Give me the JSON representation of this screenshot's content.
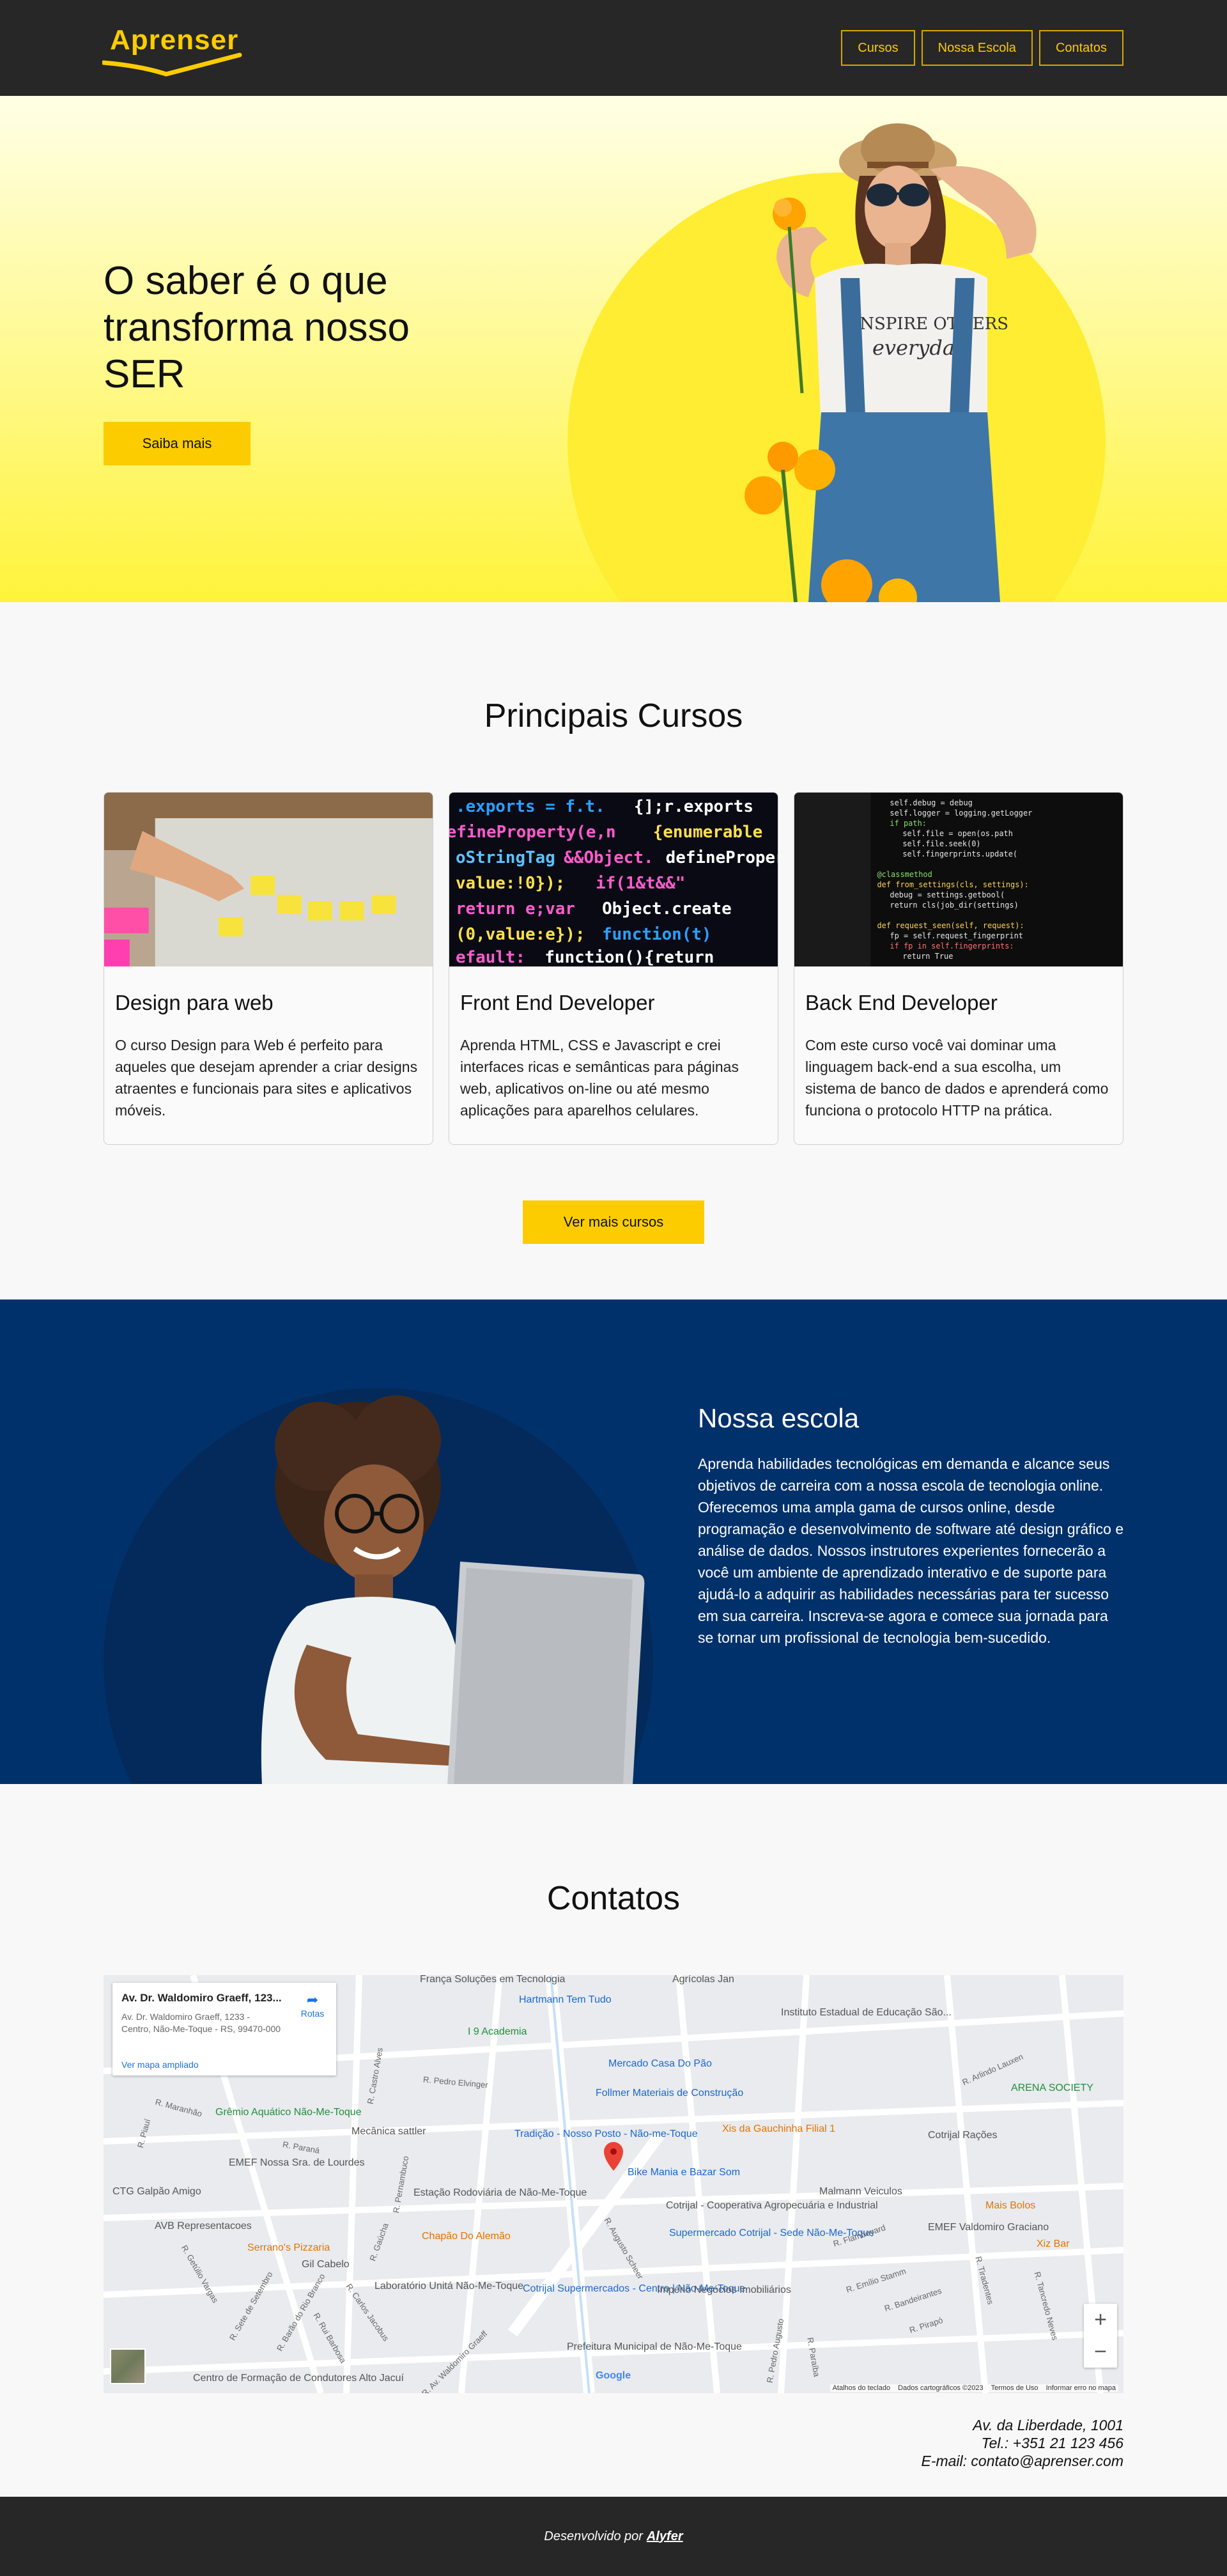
{
  "header": {
    "logo_text": "Aprenser",
    "nav": [
      "Cursos",
      "Nossa Escola",
      "Contatos"
    ]
  },
  "hero": {
    "title": "O saber é o que transforma nosso SER",
    "button": "Saiba mais",
    "shirt_text_1": "INSPIRE OTHERS",
    "shirt_text_2": "everyday"
  },
  "courses": {
    "title": "Principais Cursos",
    "items": [
      {
        "title": "Design para web",
        "description": "O curso Design para Web é perfeito para aqueles que desejam aprender a criar designs atraentes e funcionais para sites e aplicativos móveis."
      },
      {
        "title": "Front End Developer",
        "description": "Aprenda HTML, CSS e Javascript e crei interfaces ricas e semânticas para páginas web, aplicativos on-line ou até mesmo aplicações para aparelhos celulares."
      },
      {
        "title": "Back End Developer",
        "description": "Com este curso você vai dominar uma linguagem back-end a sua escolha, um sistema de banco de dados e aprenderá como funciona o protocolo HTTP na prática."
      }
    ],
    "more_button": "Ver mais cursos"
  },
  "school": {
    "title": "Nossa escola",
    "text": "Aprenda habilidades tecnológicas em demanda e alcance seus objetivos de carreira com a nossa escola de tecnologia online. Oferecemos uma ampla gama de cursos online, desde programação e desenvolvimento de software até design gráfico e análise de dados. Nossos instrutores experientes fornecerão a você um ambiente de aprendizado interativo e de suporte para ajudá-lo a adquirir as habilidades necessárias para ter sucesso em sua carreira. Inscreva-se agora e comece sua jornada para se tornar um profissional de tecnologia bem-sucedido."
  },
  "contacts": {
    "title": "Contatos",
    "map": {
      "place_name": "Av. Dr. Waldomiro Graeff, 123...",
      "place_address": "Av. Dr. Waldomiro Graeff, 1233 - Centro, Não-Me-Toque - RS, 99470-000",
      "route_label": "Rotas",
      "expand_link": "Ver mapa ampliado",
      "google": "Google",
      "footer": [
        "Atalhos do teclado",
        "Dados cartográficos ©2023",
        "Termos de Uso",
        "Informar erro no mapa"
      ],
      "places": [
        {
          "name": "França Soluções em Tecnologia",
          "style": "gray"
        },
        {
          "name": "Agrícolas Jan",
          "style": "gray"
        },
        {
          "name": "Hartmann Tem Tudo",
          "style": "blue"
        },
        {
          "name": "Instituto Estadual de Educação São...",
          "style": "gray"
        },
        {
          "name": "I 9 Academia",
          "style": "green"
        },
        {
          "name": "Mercado Casa Do Pão",
          "style": "blue"
        },
        {
          "name": "Follmer Materiais de Construção",
          "style": "blue"
        },
        {
          "name": "Xis da Gauchinha Filial 1",
          "style": "orange"
        },
        {
          "name": "ARENA SOCIETY",
          "style": "green"
        },
        {
          "name": "Grêmio Aquático Não-Me-Toque",
          "style": "green"
        },
        {
          "name": "Mecânica sattler",
          "style": "gray"
        },
        {
          "name": "Tradição - Nosso Posto - Não-me-Toque",
          "style": "blue"
        },
        {
          "name": "Cotrijal Rações",
          "style": "gray"
        },
        {
          "name": "EMEF Nossa Sra. de Lourdes",
          "style": "gray"
        },
        {
          "name": "Bike Mania e Bazar Som",
          "style": "blue"
        },
        {
          "name": "CTG Galpão Amigo",
          "style": "gray"
        },
        {
          "name": "Estação Rodoviária de Não-Me-Toque",
          "style": "gray"
        },
        {
          "name": "Cotrijal - Cooperativa Agropecuária e Industrial",
          "style": "gray"
        },
        {
          "name": "Malmann Veiculos",
          "style": "gray"
        },
        {
          "name": "Mais Bolos",
          "style": "orange"
        },
        {
          "name": "AVB Representacoes",
          "style": "gray"
        },
        {
          "name": "Chapão Do Alemão",
          "style": "orange"
        },
        {
          "name": "Supermercado Cotrijal - Sede Não-Me-Toque",
          "style": "blue"
        },
        {
          "name": "EMEF Valdomiro Graciano",
          "style": "gray"
        },
        {
          "name": "Xiz Bar",
          "style": "orange"
        },
        {
          "name": "Serrano's Pizzaria",
          "style": "orange"
        },
        {
          "name": "Gil Cabelo",
          "style": "gray"
        },
        {
          "name": "Laboratório Unitá Não-Me-Toque",
          "style": "gray"
        },
        {
          "name": "Cotrijal Supermercados - Centro | Não-Me-Toque",
          "style": "blue"
        },
        {
          "name": "Império Negócios Imobiliários",
          "style": "gray"
        },
        {
          "name": "Prefeitura Municipal de Não-Me-Toque",
          "style": "gray"
        },
        {
          "name": "Centro de Formação de Condutores Alto Jacuí",
          "style": "gray"
        }
      ],
      "streets": [
        "R. Arlindo Lauxen",
        "R. Pedro Elvinger",
        "R. Castro Alves",
        "R. Maranhão",
        "R. Paraná",
        "R. Pernambuco",
        "R. Gaúcha",
        "R. Piauí",
        "R. Getúlio Vargas",
        "R. Sete de Setembro",
        "R. Barão do Rio Branco",
        "R. Rui Barbosa",
        "R. Carlos Jacobus",
        "R. Av. Waldomiro Graeff",
        "R. Augusto Scheer",
        "R. Flambeyard",
        "R. Emílio Stamm",
        "R. Bandeirantes",
        "R. Pirapó",
        "R. Tiradentes",
        "R. Pedro Augusto",
        "R. Paraíba",
        "R. Tancredo Neves",
        "R. Tiradentes"
      ]
    },
    "address": "Av. da Liberdade, 1001",
    "phone": "Tel.: +351 21 123 456",
    "email": "E-mail: contato@aprenser.com"
  },
  "footer": {
    "prefix": "Desenvolvido por",
    "author": "Alyfer"
  },
  "colors": {
    "accent": "#fccc00",
    "dark": "#272727",
    "navy": "#01316b"
  }
}
